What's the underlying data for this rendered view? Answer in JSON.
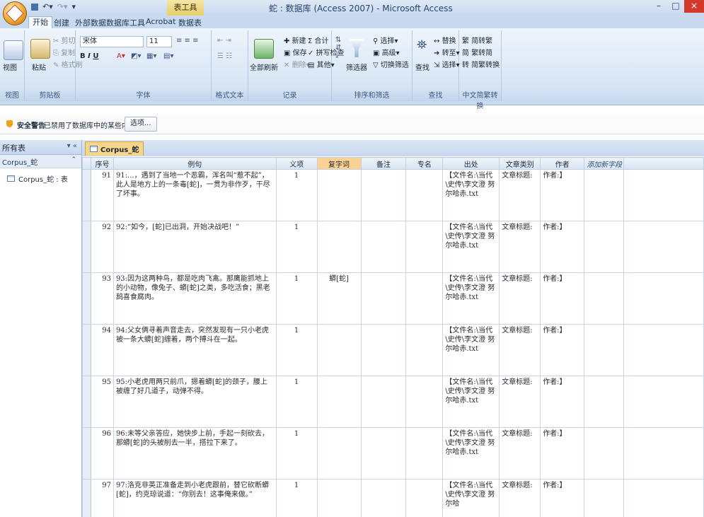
{
  "title_bar": {
    "window_title": "蛇 : 数据库 (Access 2007) - Microsoft Access",
    "contextual_tab": "表工具",
    "controls": [
      "–",
      "□",
      "×"
    ]
  },
  "tabs": [
    "开始",
    "创建",
    "外部数据",
    "数据库工具",
    "Acrobat",
    "数据表"
  ],
  "ribbon": {
    "groups": {
      "view": "视图",
      "clipboard": "剪贴板",
      "font": "字体",
      "rich_text": "格式文本",
      "records": "记录",
      "sort_filter": "排序和筛选",
      "find": "查找",
      "chinese_convert": "中文简繁转换"
    },
    "view_button": "视图",
    "paste_button": "粘贴",
    "cut": "剪切",
    "copy": "复制",
    "format_painter": "格式刷",
    "font_name": "宋体",
    "font_size": "11",
    "refresh_all": "全部刷新",
    "new": "新建",
    "save": "保存",
    "delete": "删除",
    "totals": "合计",
    "spelling": "拼写检查",
    "more": "其他",
    "filter": "筛选器",
    "selection": "选择",
    "advanced": "高级",
    "toggle_filter": "切换筛选",
    "find_button": "查找",
    "replace": "替换",
    "goto": "转至",
    "select": "选择",
    "to_traditional": "简繁转换",
    "simp_to_trad": "简转繁",
    "trad_to_simp": "繁转简",
    "simp_trad_convert": "简繁转换"
  },
  "security_bar": {
    "label": "安全警告",
    "message": "已禁用了数据库中的某些内容",
    "button": "选项..."
  },
  "nav_pane": {
    "header": "所有表",
    "group": "Corpus_蛇",
    "item": "Corpus_蛇 : 表"
  },
  "doc_tab": "Corpus_蛇",
  "table": {
    "columns": [
      "序号",
      "例句",
      "义项",
      "复字词",
      "备注",
      "专名",
      "出处",
      "文章类别",
      "作者",
      "添加新字段"
    ],
    "rows": [
      {
        "id": "91",
        "sentence": "91:...，遇到了当地一个恶霸，浑名叫“惹不起”，此人是地方上的一条毒[蛇]，一贯为非作歹，干尽了坏事。",
        "sense": "1",
        "compound": "",
        "source": "【文件名:\\当代\\史传\\李文澄 努尔哈赤.txt",
        "category": "文章标题:",
        "author": "作者:】"
      },
      {
        "id": "92",
        "sentence": "92:“如今，[蛇]已出洞，开始决战吧！”",
        "sense": "1",
        "compound": "",
        "source": "【文件名:\\当代\\史传\\李文澄 努尔哈赤.txt",
        "category": "文章标题:",
        "author": "作者:】"
      },
      {
        "id": "93",
        "sentence": "93:因为这两种鸟，都是吃肉飞禽。那鹰能抓地上的小动物，像兔子、蟒[蛇]之类，多吃活食；黑老鸹喜食腐肉。",
        "sense": "1",
        "compound": "蟒[蛇]",
        "source": "【文件名:\\当代\\史传\\李文澄 努尔哈赤.txt",
        "category": "文章标题:",
        "author": "作者:】"
      },
      {
        "id": "94",
        "sentence": "94:父女俩寻着声音走去，突然发现有一只小老虎被一条大蟒[蛇]缠着，两个搏斗在一起。",
        "sense": "1",
        "compound": "",
        "source": "【文件名:\\当代\\史传\\李文澄 努尔哈赤.txt",
        "category": "文章标题:",
        "author": "作者:】"
      },
      {
        "id": "95",
        "sentence": "95:小老虎用两只前爪，摁着蟒[蛇]的颈子，腰上被缠了好几道子，动弹不得。",
        "sense": "1",
        "compound": "",
        "source": "【文件名:\\当代\\史传\\李文澄 努尔哈赤.txt",
        "category": "文章标题:",
        "author": "作者:】"
      },
      {
        "id": "96",
        "sentence": "96:未等父亲答应，她快步上前，手起一刻砍去，那蟒[蛇]的头被削去一半，搭拉下来了。",
        "sense": "1",
        "compound": "",
        "source": "【文件名:\\当代\\史传\\李文澄 努尔哈赤.txt",
        "category": "文章标题:",
        "author": "作者:】"
      },
      {
        "id": "97",
        "sentence": "97:洛克非英正准备走到小老虎跟前，替它砍断蟒[蛇]，约克琼说道：“你别去！这事俺来做。”",
        "sense": "1",
        "compound": "",
        "source": "【文件名:\\当代\\史传\\李文澄 努尔哈",
        "category": "文章标题:",
        "author": "作者:】"
      }
    ]
  }
}
